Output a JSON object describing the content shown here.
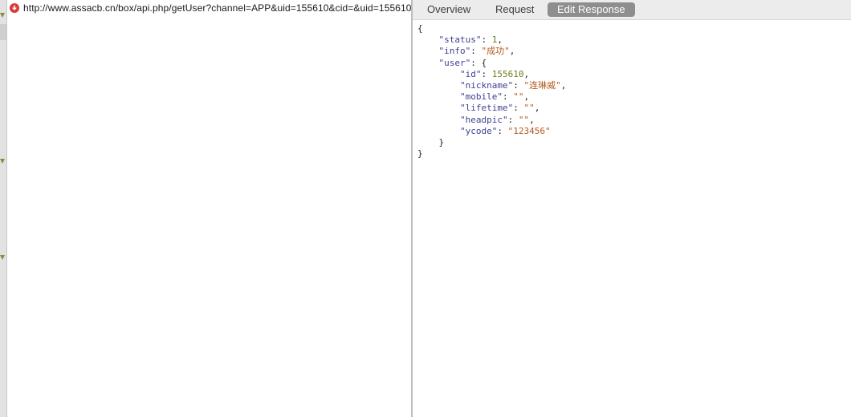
{
  "request_list": {
    "url": "http://www.assacb.cn/box/api.php/getUser?channel=APP&uid=155610&cid=&uid=155610"
  },
  "tabs": {
    "overview": "Overview",
    "request": "Request",
    "edit_response": "Edit Response",
    "active": "Edit Response"
  },
  "response": {
    "lines": [
      {
        "indent": "",
        "parts": [
          {
            "t": "{",
            "c": "p"
          }
        ]
      },
      {
        "indent": "    ",
        "parts": [
          {
            "t": "\"status\"",
            "c": "k"
          },
          {
            "t": ": ",
            "c": "p"
          },
          {
            "t": "1",
            "c": "n"
          },
          {
            "t": ",",
            "c": "p"
          }
        ]
      },
      {
        "indent": "    ",
        "parts": [
          {
            "t": "\"info\"",
            "c": "k"
          },
          {
            "t": ": ",
            "c": "p"
          },
          {
            "t": "\"成功\"",
            "c": "s"
          },
          {
            "t": ",",
            "c": "p"
          }
        ]
      },
      {
        "indent": "    ",
        "parts": [
          {
            "t": "\"user\"",
            "c": "k"
          },
          {
            "t": ": {",
            "c": "p"
          }
        ]
      },
      {
        "indent": "        ",
        "parts": [
          {
            "t": "\"id\"",
            "c": "k"
          },
          {
            "t": ": ",
            "c": "p"
          },
          {
            "t": "155610",
            "c": "n"
          },
          {
            "t": ",",
            "c": "p"
          }
        ]
      },
      {
        "indent": "        ",
        "parts": [
          {
            "t": "\"nickname\"",
            "c": "k"
          },
          {
            "t": ": ",
            "c": "p"
          },
          {
            "t": "\"连琳威\"",
            "c": "s"
          },
          {
            "t": ",",
            "c": "p"
          }
        ]
      },
      {
        "indent": "        ",
        "parts": [
          {
            "t": "\"mobile\"",
            "c": "k"
          },
          {
            "t": ": ",
            "c": "p"
          },
          {
            "t": "\"\"",
            "c": "s"
          },
          {
            "t": ",",
            "c": "p"
          }
        ]
      },
      {
        "indent": "        ",
        "parts": [
          {
            "t": "\"lifetime\"",
            "c": "k"
          },
          {
            "t": ": ",
            "c": "p"
          },
          {
            "t": "\"\"",
            "c": "s"
          },
          {
            "t": ",",
            "c": "p"
          }
        ]
      },
      {
        "indent": "        ",
        "parts": [
          {
            "t": "\"headpic\"",
            "c": "k"
          },
          {
            "t": ": ",
            "c": "p"
          },
          {
            "t": "\"\"",
            "c": "s"
          },
          {
            "t": ",",
            "c": "p"
          }
        ]
      },
      {
        "indent": "        ",
        "parts": [
          {
            "t": "\"ycode\"",
            "c": "k"
          },
          {
            "t": ": ",
            "c": "p"
          },
          {
            "t": "\"123456\"",
            "c": "s"
          }
        ]
      },
      {
        "indent": "    ",
        "parts": [
          {
            "t": "}",
            "c": "p"
          }
        ]
      },
      {
        "indent": "",
        "parts": [
          {
            "t": "}",
            "c": "p"
          }
        ]
      }
    ]
  },
  "icons": {
    "request_status": "error-icon",
    "gutter_markers": "disclosure-triangle-icon"
  },
  "colors": {
    "json_key": "#3f3f95",
    "json_string": "#b35a1c",
    "json_number": "#6b7d1a",
    "error": "#d83a3a",
    "active_tab": "#8e8e8e"
  }
}
